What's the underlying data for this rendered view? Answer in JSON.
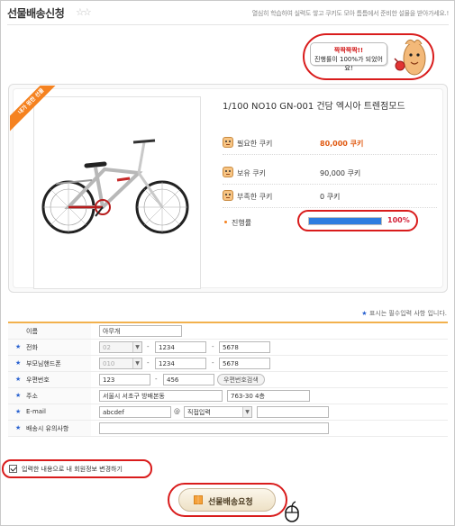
{
  "header": {
    "title": "선물배송신청",
    "description": "열심히 학습하여 실력도 쌓고 쿠키도 모아 틈틈에서 준비한 설물을 받아가세요.!"
  },
  "bubble": {
    "line1": "짝짝짝짝!!",
    "line2": "진행률이 100%가 되었어요!"
  },
  "product": {
    "ribbon": "내가 원한 선물",
    "name": "1/100 NO10 GN-001 건담 엑시아 트렌점모드",
    "rows": [
      {
        "label": "필요한 쿠키",
        "value": "80,000 쿠키"
      },
      {
        "label": "보유 쿠키",
        "value": "90,000 쿠키"
      },
      {
        "label": "부족한 쿠키",
        "value": "0 쿠키"
      }
    ],
    "progress_label": "진행률",
    "progress_fraction": 1.0,
    "progress_text": "100%"
  },
  "required_note": {
    "star": "★",
    "text": "표시는 필수입력 사항 입니다."
  },
  "form": {
    "star": "★",
    "name_label": "이름",
    "name_value": "아무개",
    "phone_label": "전화",
    "phone_prefix": "02",
    "phone_mid": "1234",
    "phone_last": "5678",
    "mobile_label": "부모님핸드폰",
    "mobile_prefix": "010",
    "mobile_mid": "1234",
    "mobile_last": "5678",
    "zip_label": "우편번호",
    "zip1": "123",
    "zip2": "456",
    "zip_button": "우편번호검색",
    "address_label": "주소",
    "address1": "서울시 서초구 방배본동",
    "address2": "763-30 4층",
    "email_label": "E-mail",
    "email_id": "abcdef",
    "email_at": "@",
    "email_domain_select": "직접입력",
    "memo_label": "배송시 유의사항",
    "dash": "-",
    "select_arrow": "▼"
  },
  "agree": {
    "label": "입력한 내용으로 내 회원정보 변경하기",
    "checked": true
  },
  "submit": {
    "label": "선물배송요청"
  }
}
